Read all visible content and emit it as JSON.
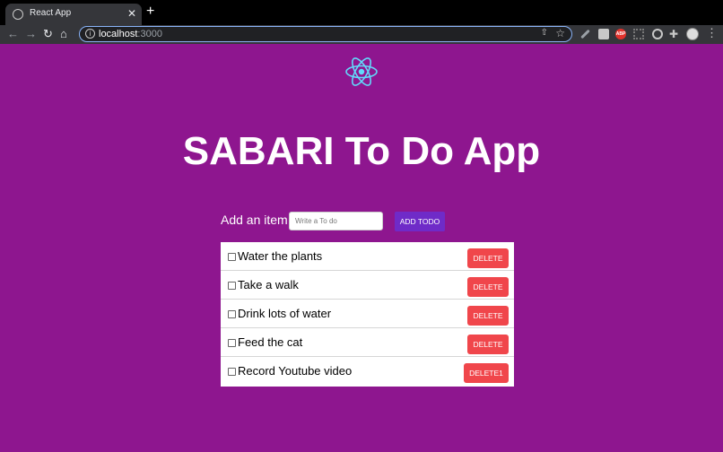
{
  "browser": {
    "tab_title": "React App",
    "tab_close": "✕",
    "new_tab": "+",
    "url_host": "localhost",
    "url_port": ":3000",
    "abp_label": "ABP"
  },
  "app": {
    "heading": "SABARI To Do App",
    "add_label": "Add an item...",
    "input_placeholder": "Write a To do",
    "input_value": "",
    "add_button": "ADD TODO",
    "todos": [
      {
        "text": "Water the plants",
        "button": "DELETE",
        "checked": false
      },
      {
        "text": "Take a walk",
        "button": "DELETE",
        "checked": false
      },
      {
        "text": "Drink lots of water",
        "button": "DELETE",
        "checked": false
      },
      {
        "text": "Feed the cat",
        "button": "DELETE",
        "checked": false
      },
      {
        "text": "Record Youtube video",
        "button": "DELETE1",
        "checked": false
      }
    ]
  },
  "colors": {
    "page_background": "#8e168f",
    "react_logo": "#61dafb",
    "add_button": "#6f2bc8",
    "delete_button": "#f0464b"
  }
}
